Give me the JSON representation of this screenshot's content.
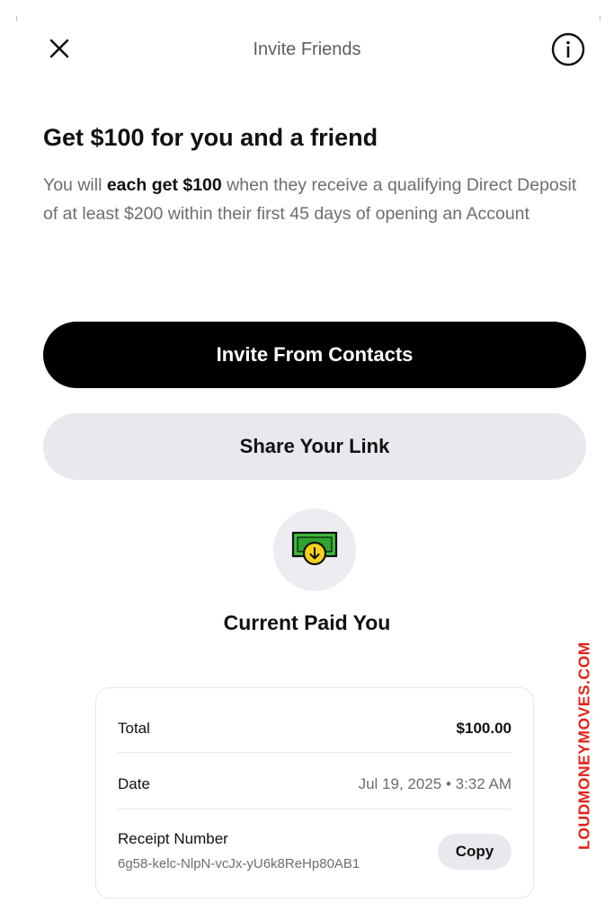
{
  "header": {
    "title": "Invite Friends",
    "close_icon": "close-icon",
    "info_icon": "info-icon"
  },
  "promo": {
    "title": "Get $100 for you and a friend",
    "desc_before": "You will ",
    "desc_bold": "each get $100",
    "desc_after": " when they receive a qualifying Direct Deposit of at least $200 within their first 45 days of opening an Account"
  },
  "actions": {
    "invite_contacts": "Invite From Contacts",
    "share_link": "Share Your Link"
  },
  "payment": {
    "icon": "money-received-icon",
    "heading": "Current Paid You",
    "colors": {
      "bill": "#3dbb3a",
      "coin": "#f5cf1b"
    }
  },
  "receipt": {
    "total_label": "Total",
    "total_value": "$100.00",
    "date_label": "Date",
    "date_value": "Jul 19, 2025 • 3:32 AM",
    "receipt_label": "Receipt Number",
    "receipt_value": "6g58-kelc-NlpN-vcJx-yU6k8ReHp80AB1",
    "copy_label": "Copy"
  },
  "watermark": {
    "text": "LOUDMONEYMOVES.COM",
    "color": "#e2231a"
  }
}
